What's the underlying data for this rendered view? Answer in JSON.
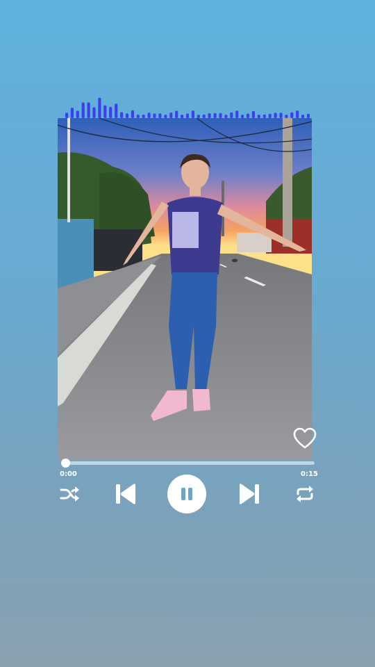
{
  "player": {
    "elapsed_time": "0:00",
    "total_time": "0:15",
    "progress_fraction": 0.0,
    "liked": false,
    "is_playing": true
  },
  "equalizer": {
    "bar_count": 45,
    "bar_color": "#3c3ff0"
  },
  "icons": {
    "like": "heart-outline-icon",
    "shuffle": "shuffle-icon",
    "previous": "skip-previous-icon",
    "play_pause": "pause-icon",
    "next": "skip-next-icon",
    "repeat": "repeat-icon"
  },
  "colors": {
    "accent": "#ffffff",
    "equalizer": "#3c3ff0",
    "pause_glyph": "#6aa6c9"
  }
}
